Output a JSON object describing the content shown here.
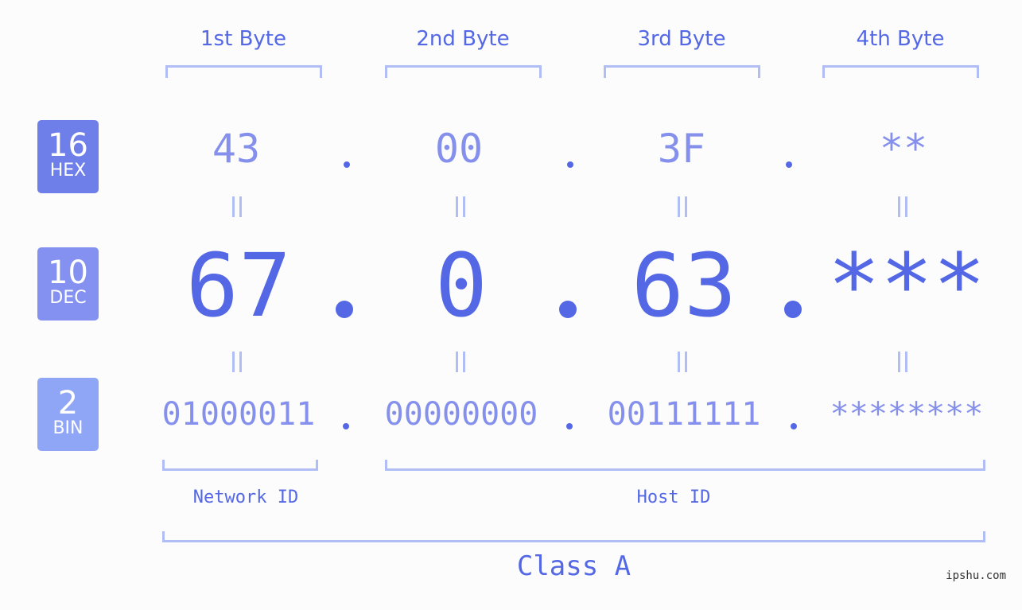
{
  "headers": [
    "1st Byte",
    "2nd Byte",
    "3rd Byte",
    "4th Byte"
  ],
  "badges": {
    "hex": {
      "base": "16",
      "label": "HEX",
      "color": "#6f7fe9"
    },
    "dec": {
      "base": "10",
      "label": "DEC",
      "color": "#8491f0"
    },
    "bin": {
      "base": "2",
      "label": "BIN",
      "color": "#8fa5f6"
    }
  },
  "hex": [
    "43",
    "00",
    "3F",
    "**"
  ],
  "dec": [
    "67",
    "0",
    "63",
    "***"
  ],
  "bin": [
    "01000011",
    "00000000",
    "00111111",
    "********"
  ],
  "separator": ".",
  "network_label": "Network ID",
  "host_label": "Host ID",
  "class_label": "Class A",
  "watermark": "ipshu.com",
  "colors": {
    "accent": "#5468e6",
    "light": "#8590ec",
    "bracket": "#b1bdf5"
  }
}
